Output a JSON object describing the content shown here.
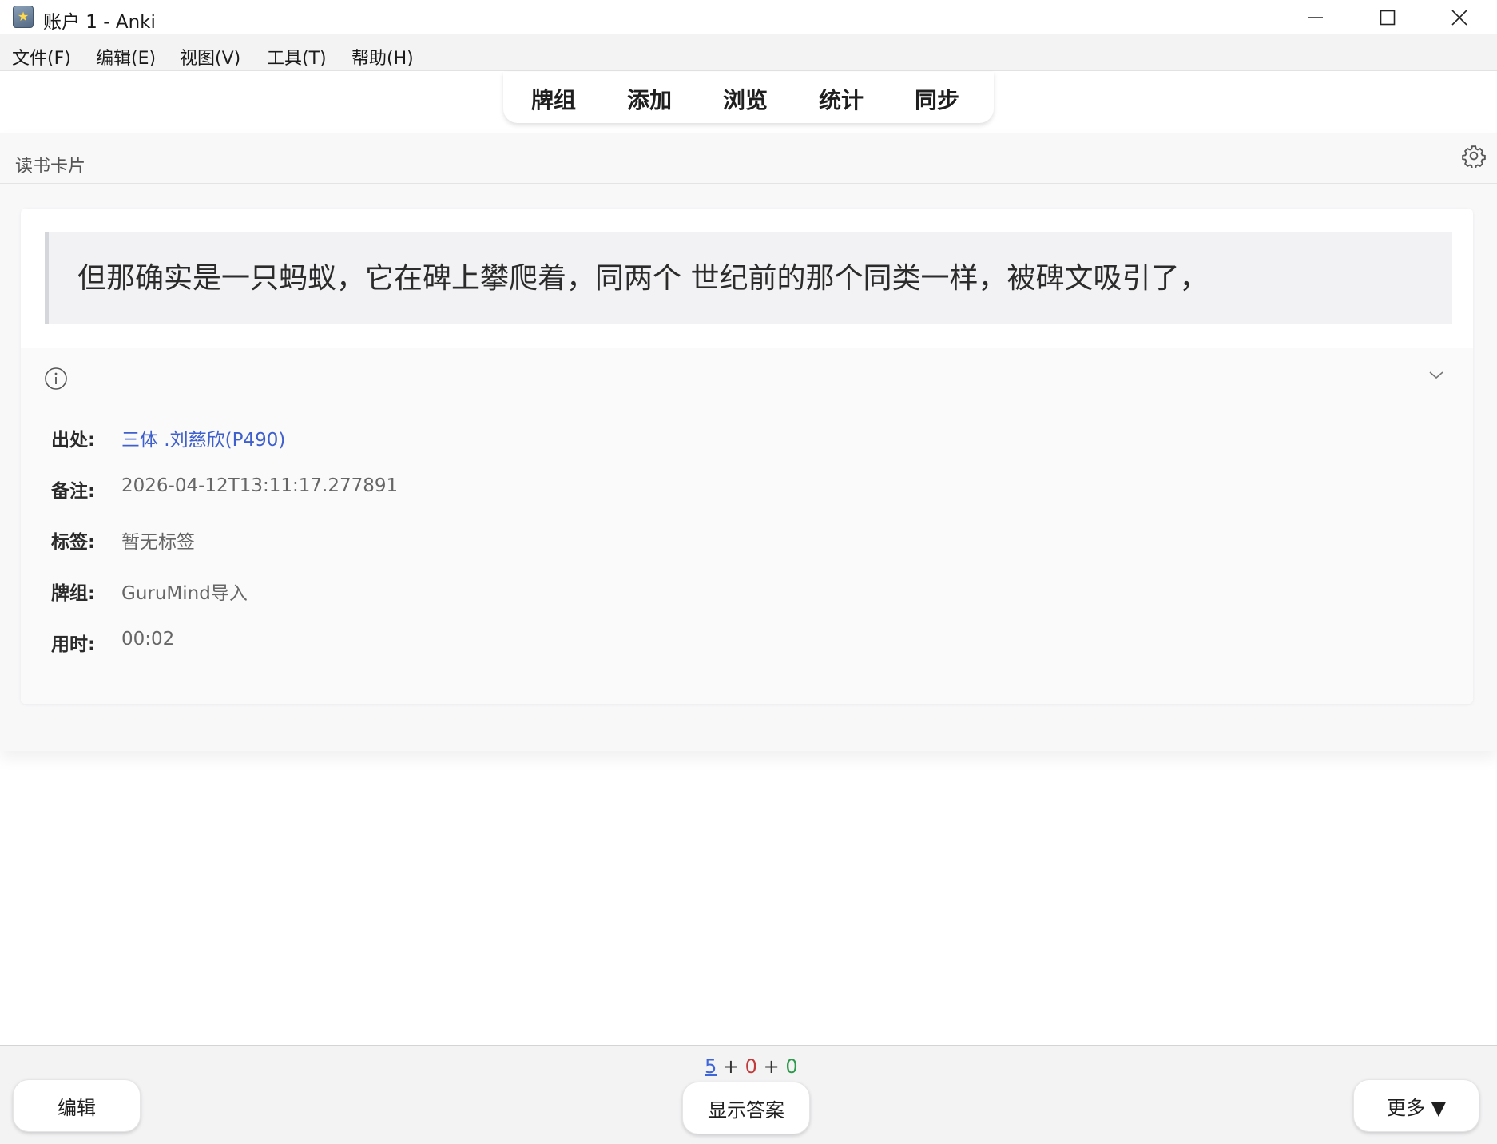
{
  "window": {
    "title": "账户 1 - Anki"
  },
  "menu": {
    "items": [
      "文件(F)",
      "编辑(E)",
      "视图(V)",
      "工具(T)",
      "帮助(H)"
    ]
  },
  "toolbar": {
    "items": [
      "牌组",
      "添加",
      "浏览",
      "统计",
      "同步"
    ]
  },
  "deck": {
    "name": "读书卡片"
  },
  "card": {
    "quote": "但那确实是一只蚂蚁，它在碑上攀爬着，同两个 世纪前的那个同类一样，被碑文吸引了，",
    "meta": {
      "source_label": "出处:",
      "source_value": "三体 .刘慈欣(P490)",
      "note_label": "备注:",
      "note_value": "2026-04-12T13:11:17.277891",
      "tags_label": "标签:",
      "tags_value": "暂无标签",
      "deck_label": "牌组:",
      "deck_value": "GuruMind导入",
      "time_label": "用时:",
      "time_value": "00:02"
    }
  },
  "bottom": {
    "counts": {
      "new": "5",
      "plus1": " + ",
      "learning": "0",
      "plus2": " + ",
      "review": "0"
    },
    "edit_label": "编辑",
    "show_answer_label": "显示答案",
    "more_label": "更多 ▼"
  },
  "colors": {
    "link": "#3f5fcc",
    "new_count": "#3f66d9",
    "learning_count": "#c23a3a",
    "review_count": "#2e9a4b"
  }
}
